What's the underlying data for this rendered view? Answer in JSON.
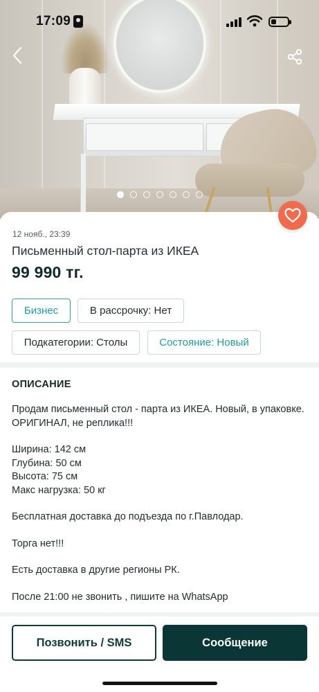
{
  "status_bar": {
    "time": "17:09"
  },
  "gallery": {
    "photo_count": 7,
    "active_index": 0
  },
  "listing": {
    "date": "12 нояб., 23:39",
    "title": "Письменный стол-парта из ИКЕА",
    "price": "99 990 тг."
  },
  "chips": {
    "business": "Бизнес",
    "installments": "В рассрочку: Нет",
    "subcategory": "Подкатегории: Столы",
    "condition": "Состояние: Новый"
  },
  "description": {
    "heading": "ОПИСАНИЕ",
    "para1": "Продам письменный стол - парта из ИКЕА. Новый, в упаковке. ОРИГИНАЛ, не реплика!!!",
    "width": "Ширина: 142 см",
    "depth": "Глубина: 50 см",
    "height": "Высота: 75 см",
    "max_load": "Макс нагрузка: 50 кг",
    "delivery": "Бесплатная доставка до подъезда по г.Павлодар.",
    "no_bargain": "Торга нет!!!",
    "regions": "Есть доставка в другие регионы РК.",
    "contact_note": "После 21:00 не звонить , пишите на WhatsApp"
  },
  "actions": {
    "call_label": "Позвонить / SMS",
    "message_label": "Сообщение"
  },
  "colors": {
    "accent_teal": "#1f9e9c",
    "primary_dark": "#0b3636",
    "favorite": "#f06b4e"
  }
}
